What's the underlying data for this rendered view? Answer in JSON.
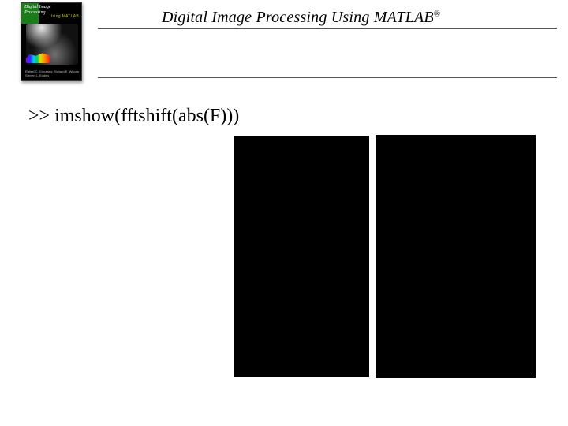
{
  "header": {
    "title_main": "Digital Image Processing Using MATLAB",
    "title_reg": "®"
  },
  "book": {
    "line1": "Digital Image",
    "line2": "Processing",
    "matlab": "Using MATLAB",
    "authors": "Rafael C. Gonzalez\nRichard E. Woods\nSteven L. Eddins"
  },
  "command": ">> imshow(fftshift(abs(F)))"
}
